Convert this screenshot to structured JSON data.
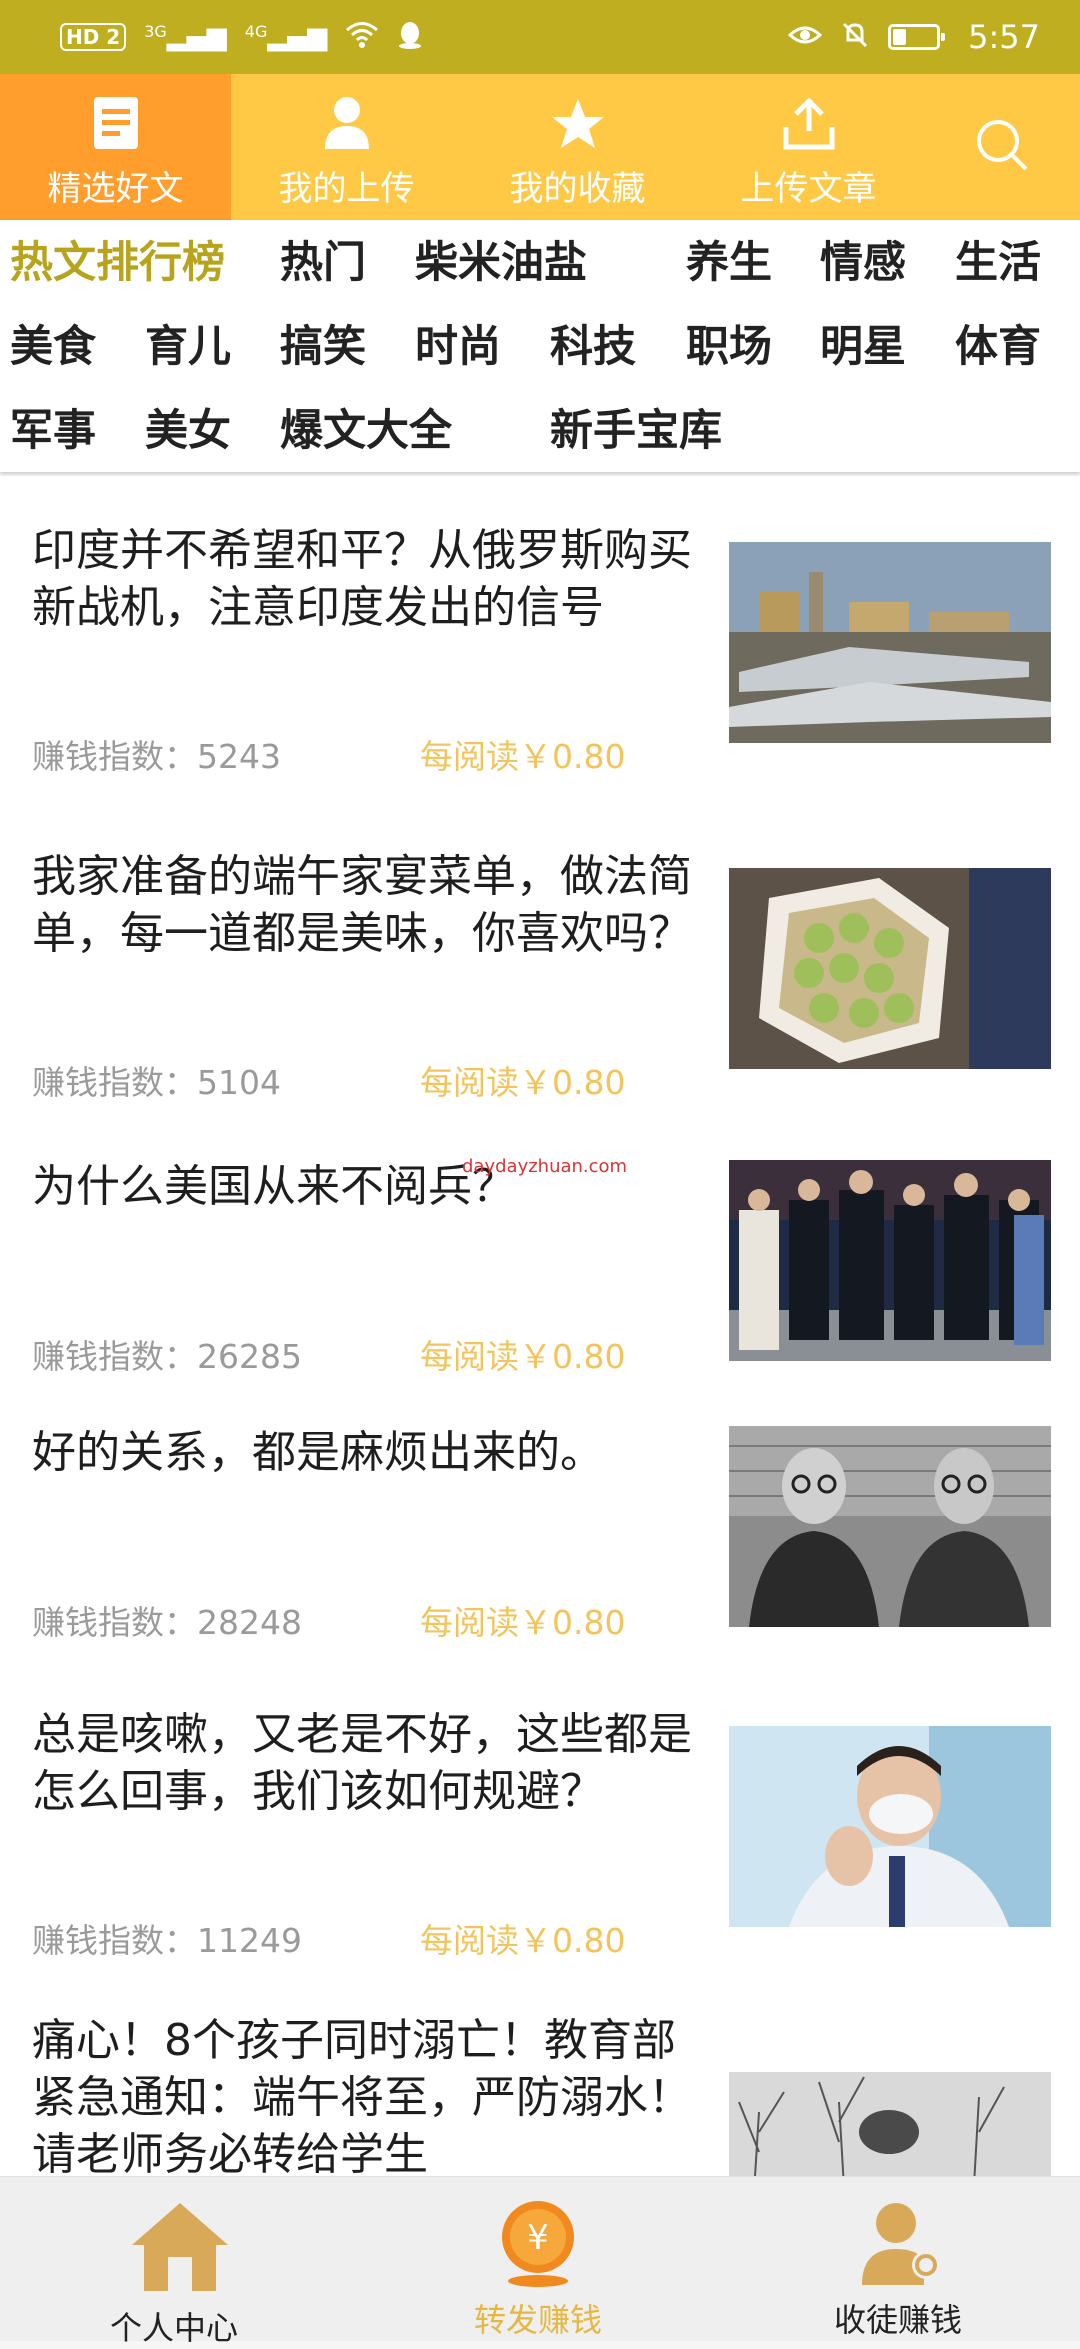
{
  "status_bar": {
    "network": "HD 2",
    "signal_1": "3G",
    "signal_2": "4G",
    "time": "5:57"
  },
  "top_tabs": [
    {
      "label": "精选好文",
      "icon": "document-icon",
      "active": true
    },
    {
      "label": "我的上传",
      "icon": "user-icon",
      "active": false
    },
    {
      "label": "我的收藏",
      "icon": "star-icon",
      "active": false
    },
    {
      "label": "上传文章",
      "icon": "upload-icon",
      "active": false
    }
  ],
  "search_icon": "search-icon",
  "categories": [
    {
      "label": "热文排行榜",
      "active": true
    },
    {
      "label": "热门"
    },
    {
      "label": "柴米油盐"
    },
    {
      "label": "养生"
    },
    {
      "label": "情感"
    },
    {
      "label": "生活"
    },
    {
      "label": "美食"
    },
    {
      "label": "育儿"
    },
    {
      "label": "搞笑"
    },
    {
      "label": "时尚"
    },
    {
      "label": "科技"
    },
    {
      "label": "职场"
    },
    {
      "label": "明星"
    },
    {
      "label": "体育"
    },
    {
      "label": "军事"
    },
    {
      "label": "美女"
    },
    {
      "label": "爆文大全"
    },
    {
      "label": "新手宝库"
    }
  ],
  "articles": [
    {
      "title": "印度并不希望和平？从俄罗斯购买新战机，注意印度发出的信号",
      "index_label": "赚钱指数：",
      "index_value": "5243",
      "reward": "每阅读￥0.80",
      "thumb": "fighter-jets-photo"
    },
    {
      "title": "我家准备的端午家宴菜单，做法简单，每一道都是美味，你喜欢吗？",
      "index_label": "赚钱指数：",
      "index_value": "5104",
      "reward": "每阅读￥0.80",
      "thumb": "stuffed-bitter-melon-photo"
    },
    {
      "title": "为什么美国从来不阅兵？",
      "index_label": "赚钱指数：",
      "index_value": "26285",
      "reward": "每阅读￥0.80",
      "thumb": "parade-officials-photo"
    },
    {
      "title": "好的关系，都是麻烦出来的。",
      "index_label": "赚钱指数：",
      "index_value": "28248",
      "reward": "每阅读￥0.80",
      "thumb": "historic-portrait-photo"
    },
    {
      "title": "总是咳嗽，又老是不好，这些都是怎么回事，我们该如何规避？",
      "index_label": "赚钱指数：",
      "index_value": "11249",
      "reward": "每阅读￥0.80",
      "thumb": "coughing-man-photo"
    },
    {
      "title": "痛心！8个孩子同时溺亡！教育部紧急通知：端午将至，严防溺水！请老师务必转给学生",
      "index_label": "",
      "index_value": "",
      "reward": "",
      "thumb": "tree-branches-photo"
    }
  ],
  "watermark": "daydayzhuan.com",
  "bottom_nav": [
    {
      "label": "个人中心",
      "icon": "home-icon",
      "active": false
    },
    {
      "label": "转发赚钱",
      "icon": "yuan-coin-icon",
      "active": true
    },
    {
      "label": "收徒赚钱",
      "icon": "recruit-user-icon",
      "active": false
    }
  ],
  "colors": {
    "status_bar": "#bfae1f",
    "tab_bar": "#ffc945",
    "tab_active": "#ff9e2c",
    "category_active": "#b8a41c",
    "reward": "#f3c45b"
  }
}
